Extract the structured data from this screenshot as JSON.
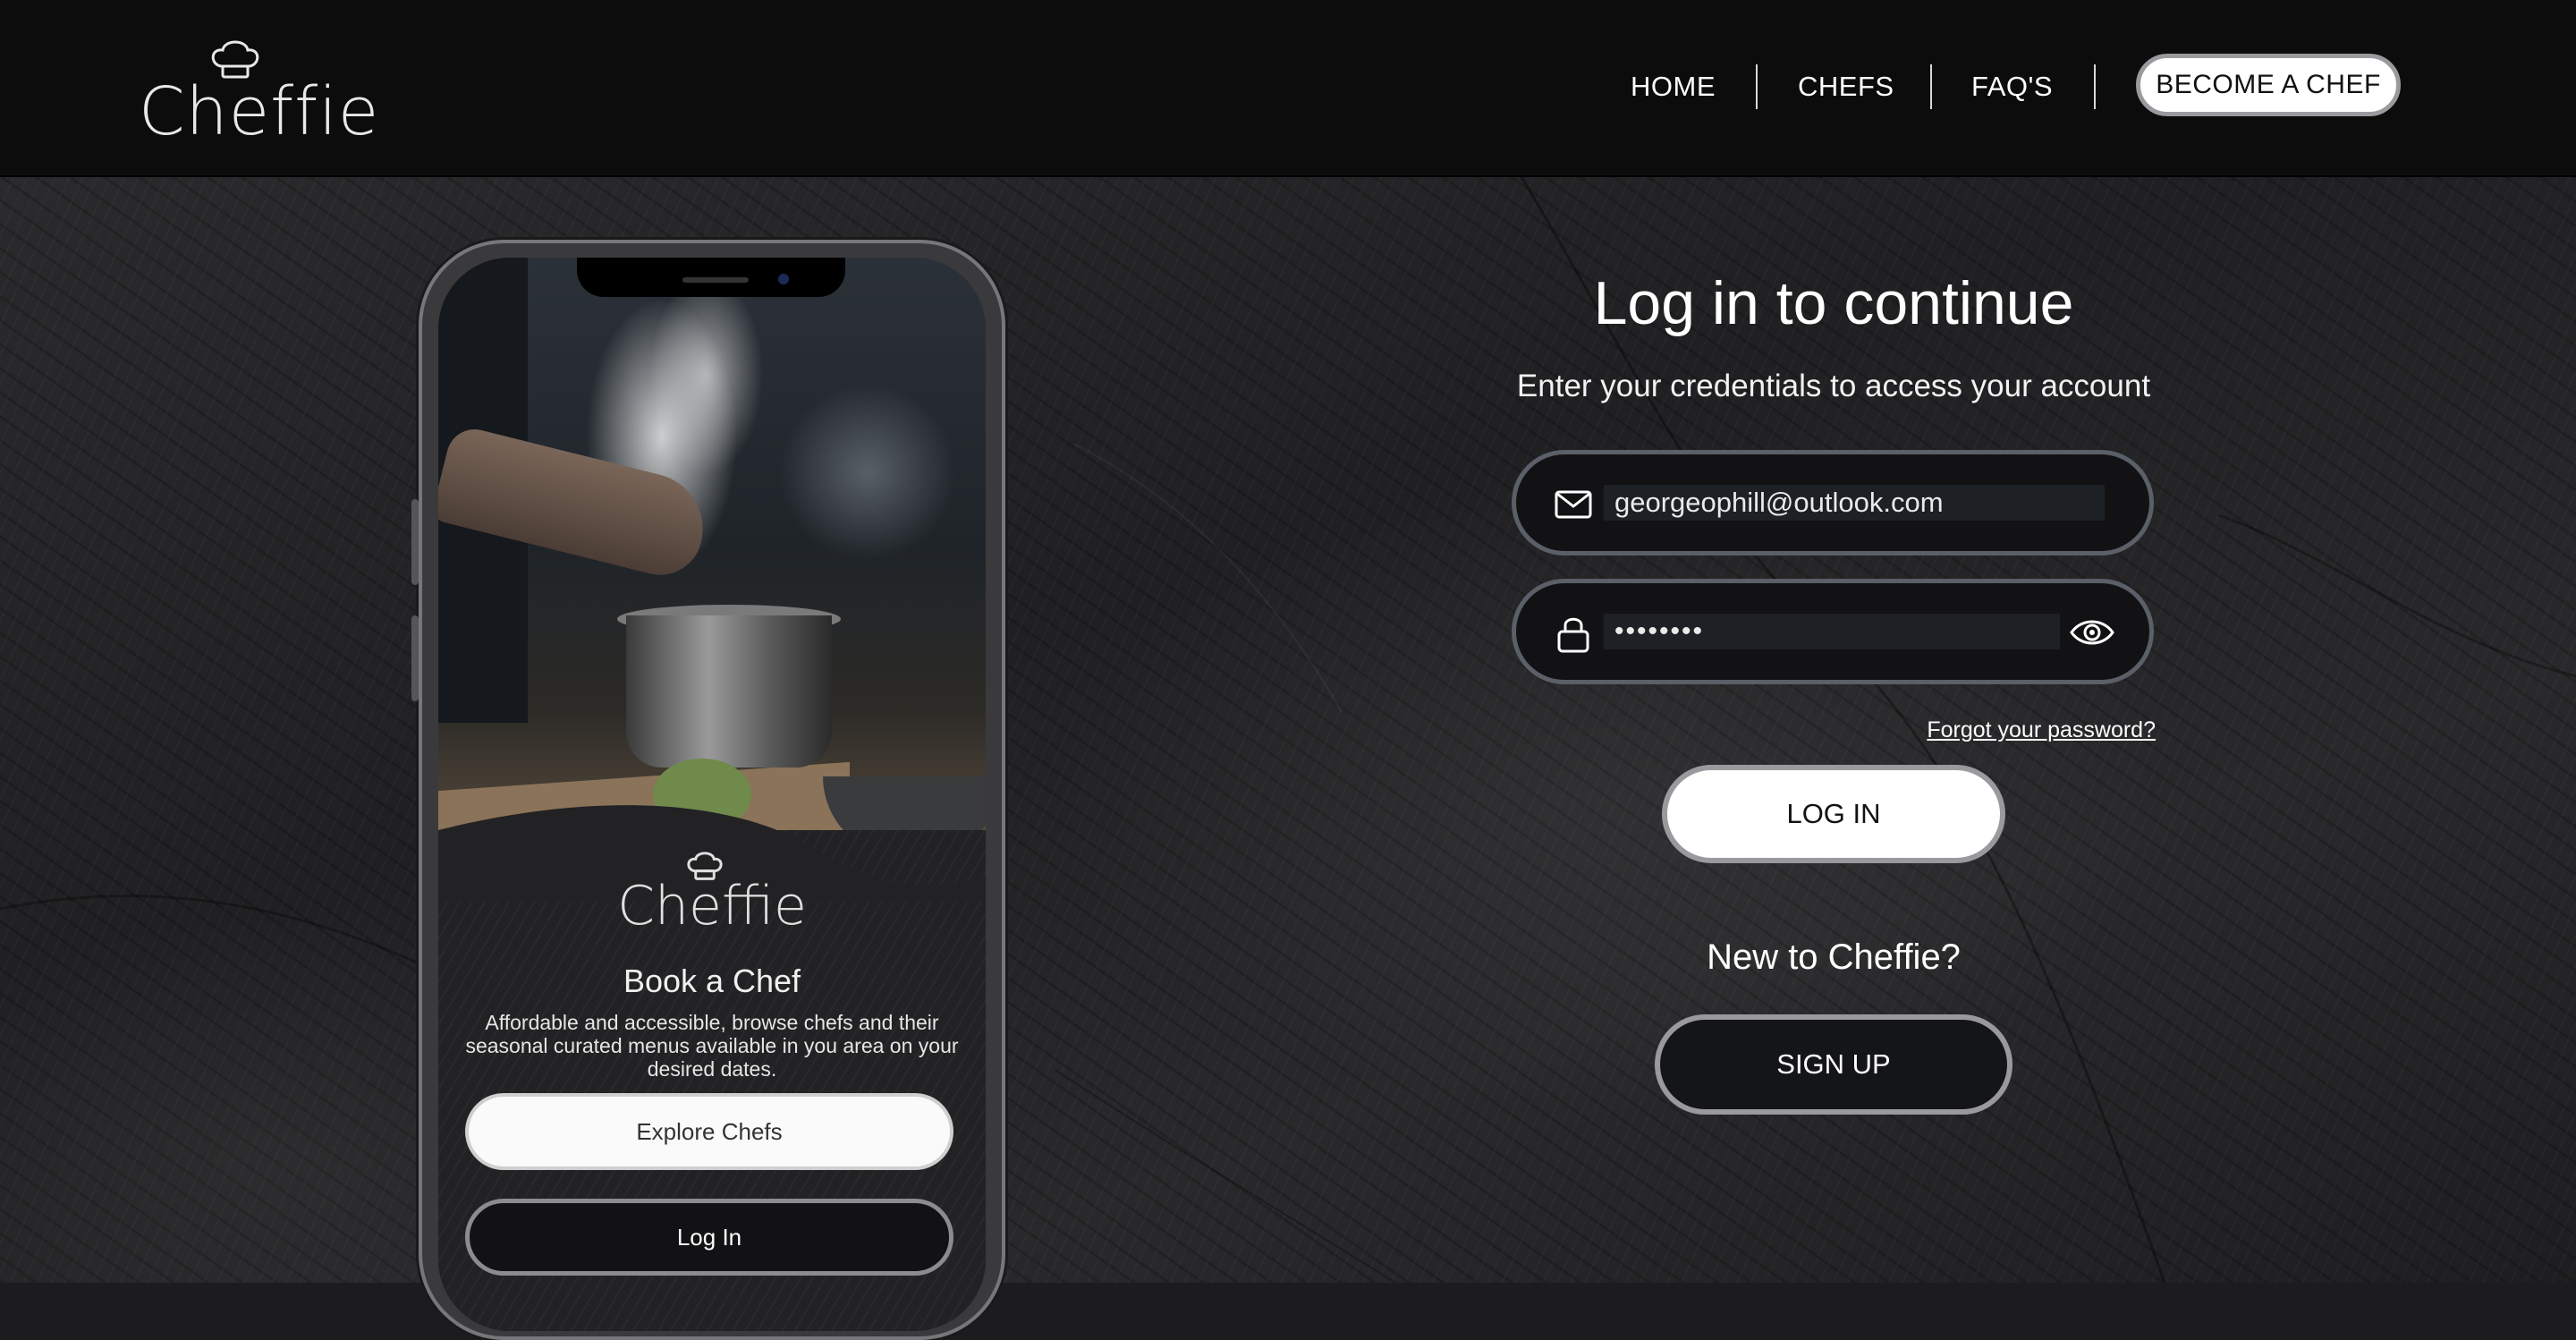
{
  "brand": {
    "name": "Cheffie"
  },
  "nav": {
    "home": "HOME",
    "chefs": "CHEFS",
    "faqs": "FAQ'S",
    "become_chef": "BECOME A CHEF"
  },
  "login": {
    "title": "Log in to continue",
    "subtitle": "Enter your credentials to access your account",
    "email_value": "georgeophill@outlook.com",
    "password_value": "••••••••",
    "forgot": "Forgot your password?",
    "login_button": "LOG IN",
    "new_prompt": "New to Cheffie?",
    "signup_button": "SIGN UP"
  },
  "phone": {
    "brand": "Cheffie",
    "title": "Book a Chef",
    "description": "Affordable and accessible, browse chefs and their seasonal curated menus available in you area on your desired dates.",
    "explore_button": "Explore Chefs",
    "login_button": "Log In"
  },
  "icons": {
    "logo": "chef-hat-icon",
    "email": "envelope-icon",
    "password": "lock-icon",
    "toggle": "eye-icon"
  },
  "colors": {
    "header_bg": "#0c0c0c",
    "field_bg": "#121214",
    "field_border": "#5a5f68",
    "button_light": "#ffffff",
    "button_border": "#9a9a9e"
  }
}
